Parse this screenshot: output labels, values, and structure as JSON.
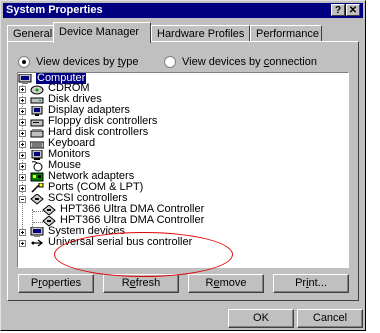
{
  "window": {
    "title": "System Properties",
    "help_btn": "?",
    "close_btn": "✕"
  },
  "tabs": [
    {
      "label": "General"
    },
    {
      "label": "Device Manager"
    },
    {
      "label": "Hardware Profiles"
    },
    {
      "label": "Performance"
    }
  ],
  "view": {
    "by_type": {
      "pre": "View devices by ",
      "ul": "t",
      "post": "ype"
    },
    "by_connection": {
      "pre": "View devices by ",
      "ul": "c",
      "post": "onnection"
    }
  },
  "tree": {
    "root": "Computer",
    "items": [
      {
        "label": "CDROM",
        "icon": "cdrom-icon"
      },
      {
        "label": "Disk drives",
        "icon": "disk-drive-icon"
      },
      {
        "label": "Display adapters",
        "icon": "display-adapter-icon"
      },
      {
        "label": "Floppy disk controllers",
        "icon": "floppy-controller-icon"
      },
      {
        "label": "Hard disk controllers",
        "icon": "hard-disk-controller-icon"
      },
      {
        "label": "Keyboard",
        "icon": "keyboard-icon"
      },
      {
        "label": "Monitors",
        "icon": "monitor-icon"
      },
      {
        "label": "Mouse",
        "icon": "mouse-icon"
      },
      {
        "label": "Network adapters",
        "icon": "network-adapter-icon"
      },
      {
        "label": "Ports (COM & LPT)",
        "icon": "port-icon"
      },
      {
        "label": "SCSI controllers",
        "icon": "scsi-controller-icon"
      },
      {
        "label": "HPT366 Ultra DMA Controller",
        "icon": "scsi-device-icon"
      },
      {
        "label": "HPT366 Ultra DMA Controller",
        "icon": "scsi-device-icon"
      },
      {
        "label": "System devices",
        "icon": "system-device-icon"
      },
      {
        "label": "Universal serial bus controller",
        "icon": "usb-icon"
      }
    ]
  },
  "buttons": {
    "properties": {
      "pre": "P",
      "ul": "r",
      "post": "operties"
    },
    "refresh": {
      "pre": "R",
      "ul": "e",
      "post": "fresh"
    },
    "remove": {
      "pre": "R",
      "ul": "e",
      "post": "move"
    },
    "print": {
      "pre": "Pr",
      "ul": "i",
      "post": "nt..."
    },
    "ok": "OK",
    "cancel": "Cancel"
  },
  "annotation": {
    "color": "#e00000"
  }
}
